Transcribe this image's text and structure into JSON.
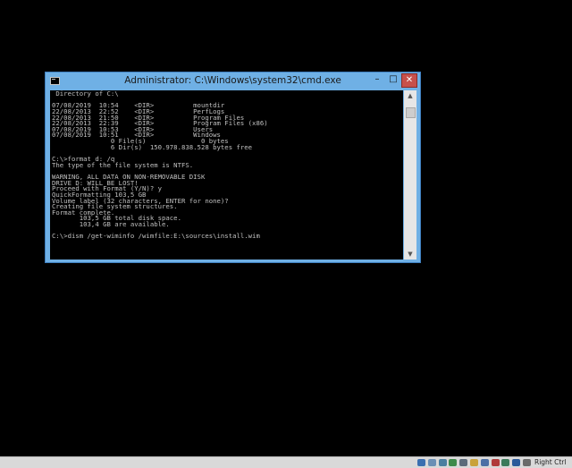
{
  "window": {
    "title": "Administrator: C:\\Windows\\system32\\cmd.exe"
  },
  "controls": {
    "minimize": "–",
    "maximize": "□",
    "close": "✕"
  },
  "scrollbar": {
    "up": "▲",
    "down": "▼"
  },
  "console": {
    "lines": [
      " Directory of C:\\",
      "",
      "07/08/2019  10:54    <DIR>          mountdir",
      "22/08/2013  22:52    <DIR>          PerfLogs",
      "22/08/2013  21:50    <DIR>          Program Files",
      "22/08/2013  22:39    <DIR>          Program Files (x86)",
      "07/08/2019  10:53    <DIR>          Users",
      "07/08/2019  10:51    <DIR>          Windows",
      "               0 File(s)              0 bytes",
      "               6 Dir(s)  150.978.838.528 bytes free",
      "",
      "C:\\>format d: /q",
      "The type of the file system is NTFS.",
      "",
      "WARNING, ALL DATA ON NON-REMOVABLE DISK",
      "DRIVE D: WILL BE LOST!",
      "Proceed with Format (Y/N)? y",
      "QuickFormatting 103,5 GB",
      "Volume label (32 characters, ENTER for none)?",
      "Creating file system structures.",
      "Format complete.",
      "       103,5 GB total disk space.",
      "       103,4 GB are available.",
      "",
      "C:\\>dism /get-wiminfo /wimfile:E:\\sources\\install.wim"
    ]
  },
  "statusbar": {
    "host_key": "Right Ctrl",
    "icons": [
      {
        "name": "hard-disk-icon",
        "color": "#3a6fb0"
      },
      {
        "name": "optical-drive-icon",
        "color": "#6a8fb5"
      },
      {
        "name": "audio-icon",
        "color": "#4a7fa0"
      },
      {
        "name": "network-icon",
        "color": "#3d8a4a"
      },
      {
        "name": "usb-icon",
        "color": "#5a6a7a"
      },
      {
        "name": "shared-folder-icon",
        "color": "#c9a23a"
      },
      {
        "name": "display-icon",
        "color": "#4a6fa5"
      },
      {
        "name": "video-capture-icon",
        "color": "#b03a3a"
      },
      {
        "name": "cpu-icon",
        "color": "#3a7a5a"
      },
      {
        "name": "mouse-integration-icon",
        "color": "#2a5a9a"
      },
      {
        "name": "keyboard-capture-icon",
        "color": "#6a6a6a"
      }
    ]
  }
}
